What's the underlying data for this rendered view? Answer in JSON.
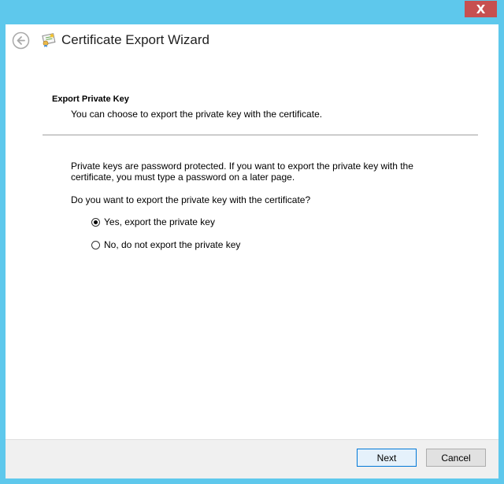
{
  "window": {
    "close_label": "X"
  },
  "header": {
    "title": "Certificate Export Wizard",
    "back_icon": "back-arrow-icon",
    "wizard_icon": "certificate-wizard-icon"
  },
  "page": {
    "section_title": "Export Private Key",
    "section_desc": "You can choose to export the private key with the certificate.",
    "info_line1": "Private keys are password protected. If you want to export the private key with the",
    "info_line2": "certificate, you must type a password on a later page.",
    "question": "Do you want to export the private key with the certificate?",
    "options": [
      {
        "label": "Yes, export the private key",
        "selected": true
      },
      {
        "label": "No, do not export the private key",
        "selected": false
      }
    ]
  },
  "footer": {
    "next_label": "Next",
    "cancel_label": "Cancel"
  },
  "colors": {
    "frame": "#5ec8ec",
    "close": "#c75050",
    "accent": "#0078d7"
  }
}
